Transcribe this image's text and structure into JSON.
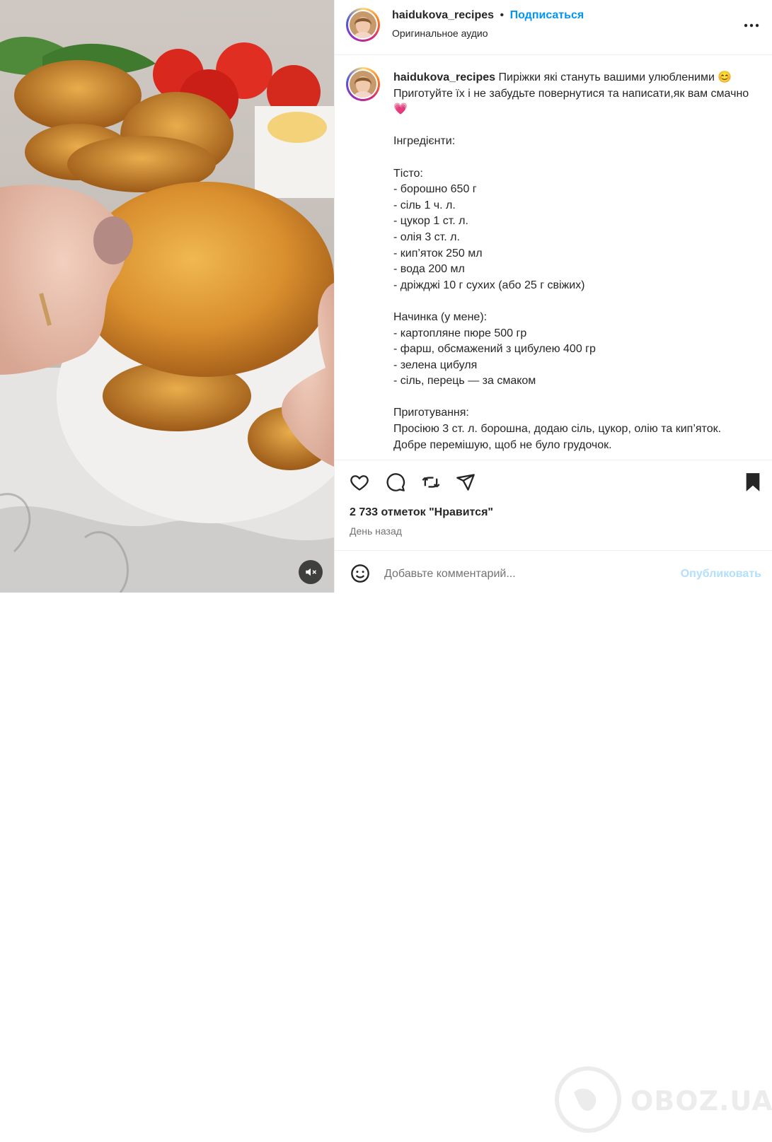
{
  "post": {
    "username": "haidukova_recipes",
    "follow_label": "Подписаться",
    "dot": "•",
    "audio": "Оригинальное аудио",
    "more": "⋯"
  },
  "caption": {
    "username": "haidukova_recipes",
    "text": " Пиріжки які стануть вашими улюбленими 😊\nПриготуйте їх і не забудьте повернутися та написати,як вам смачно💗\n\nІнгредієнти:\n\nТісто:\n- борошно 650 г\n- сіль 1 ч. л.\n- цукор 1 ст. л.\n- олія 3 ст. л.\n- кип’яток 250 мл\n- вода 200 мл\n- дріжджі 10 г сухих (або 25 г свіжих)\n\nНачинка (у мене):\n- картопляне пюре 500 гр\n- фарш, обсмажений з цибулею 400 гр\n- зелена цибуля\n- сіль, перець — за смаком\n\nПриготування:\nПросіюю 3 ст. л. борошна, додаю сіль, цукор, олію та кип’яток. Добре перемішую, щоб не було грудочок."
  },
  "stats": {
    "likes": "2 733 отметок \"Нравится\"",
    "date": "День назад"
  },
  "comment": {
    "placeholder": "Добавьте комментарий...",
    "post_label": "Опубликовать"
  },
  "watermark": {
    "text": "OBOZ.UA"
  },
  "icons": {
    "like": "heart-icon",
    "comment": "comment-icon",
    "repost": "repost-icon",
    "share": "send-icon",
    "save": "bookmark-icon",
    "emoji": "emoji-icon",
    "mute": "muted-speaker-icon",
    "more": "more-options-icon"
  },
  "colors": {
    "accent": "#0095f6",
    "muted": "#737373",
    "post_disabled": "#b2dffc"
  }
}
